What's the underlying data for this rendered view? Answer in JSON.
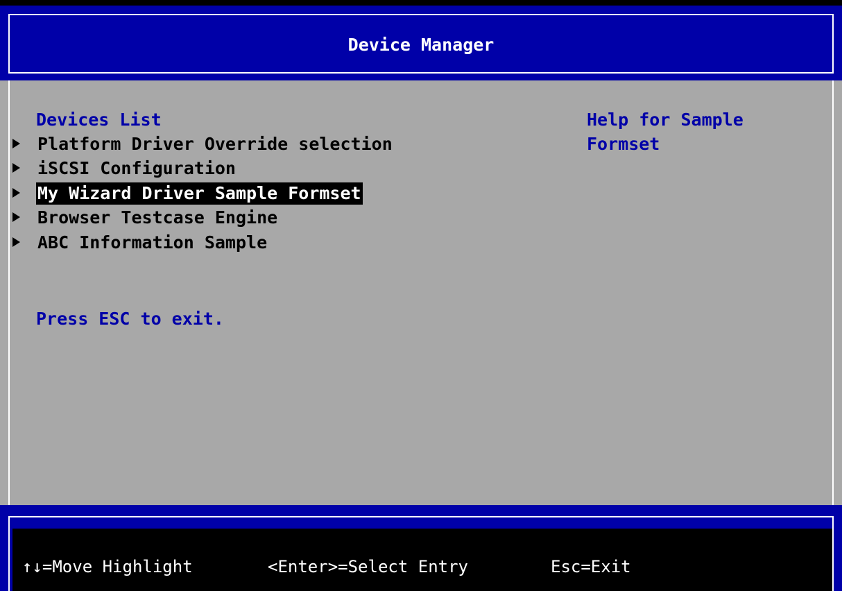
{
  "header": {
    "title": "Device Manager"
  },
  "main": {
    "section_title": "Devices List",
    "menu_items": [
      {
        "label": "Platform Driver Override selection",
        "selected": false
      },
      {
        "label": "iSCSI Configuration",
        "selected": false
      },
      {
        "label": "My Wizard Driver Sample Formset",
        "selected": true
      },
      {
        "label": "Browser Testcase Engine",
        "selected": false
      },
      {
        "label": "ABC Information Sample",
        "selected": false
      }
    ],
    "esc_hint": "Press ESC to exit.",
    "help_lines": [
      "Help for Sample",
      "Formset"
    ]
  },
  "footer": {
    "hints": [
      "↑↓=Move Highlight",
      "<Enter>=Select Entry",
      "Esc=Exit"
    ]
  },
  "colors": {
    "header_bg": "#0000a8",
    "main_bg": "#a8a8a8",
    "footer_bg": "#0000a8",
    "accent_text": "#0000a8",
    "selected_bg": "#000000",
    "selected_fg": "#ffffff",
    "menu_arrow_icon": "triangle-right-icon"
  }
}
